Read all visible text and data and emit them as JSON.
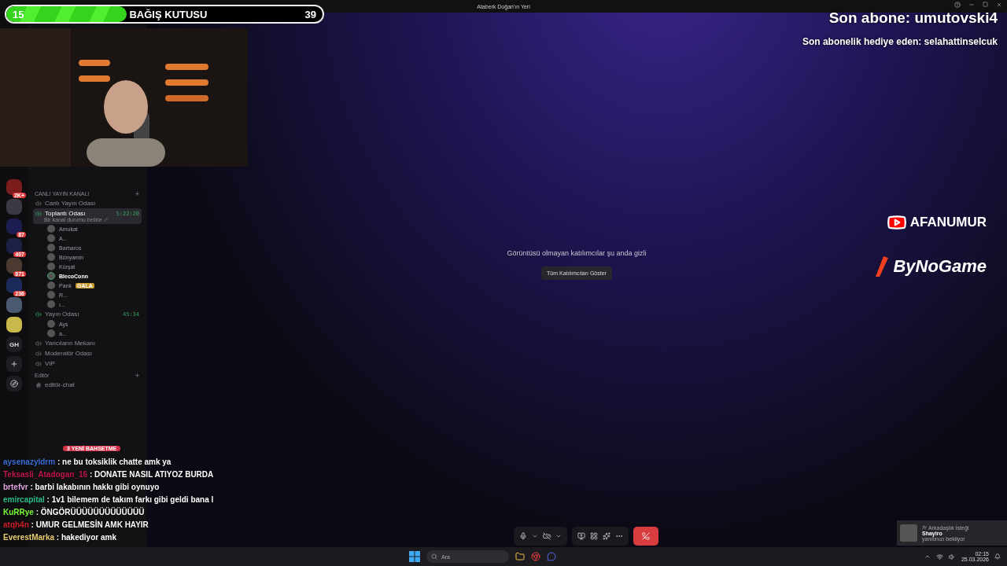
{
  "window": {
    "title": "Ataberk Doğan'ın Yeri"
  },
  "donation_bar": {
    "current": "15",
    "label": "BAĞIŞ KUTUSU",
    "goal": "39",
    "level": 0.38
  },
  "subscriber_overlay": {
    "last_sub": "Son abone: umutovski4",
    "last_gifter": "Son abonelik hediye eden: selahattinselcuk"
  },
  "sponsors": [
    "AFANUMUR",
    "ByNoGame"
  ],
  "servers": [
    {
      "kind": "avatar",
      "badge": "2K+"
    },
    {
      "kind": "avatar"
    },
    {
      "kind": "avatar",
      "badge": "87"
    },
    {
      "kind": "avatar",
      "badge": "407"
    },
    {
      "kind": "avatar",
      "badge": "871"
    },
    {
      "kind": "avatar",
      "badge": "236"
    },
    {
      "kind": "avatar"
    },
    {
      "kind": "avatar"
    },
    {
      "kind": "text",
      "label": "GH"
    },
    {
      "kind": "add"
    },
    {
      "kind": "discover"
    }
  ],
  "categories": [
    {
      "name": "CANLI YAYIN KANALI",
      "channels": [
        {
          "kind": "voice",
          "name": "Canlı Yayın Odası",
          "selected": false
        },
        {
          "kind": "voice",
          "name": "Toplantı Odası",
          "selected": true,
          "timer": "5:22:20",
          "status": "Bir kanal durumu belirle",
          "users": [
            {
              "name": "Amukat",
              "speaking": false
            },
            {
              "name": "A...",
              "speaking": false
            },
            {
              "name": "Barbaros",
              "speaking": false
            },
            {
              "name": "Bünyamin",
              "speaking": false
            },
            {
              "name": "Kürşat",
              "speaking": false
            },
            {
              "name": "BlecoConn",
              "speaking": true
            },
            {
              "name": "Pank",
              "tag": "GALA",
              "speaking": false
            },
            {
              "name": "R...",
              "speaking": false
            },
            {
              "name": "ı...",
              "speaking": false
            }
          ]
        },
        {
          "kind": "voice",
          "name": "Yayın Odası",
          "selected": false,
          "timer": "45:34",
          "users": [
            {
              "name": "Ays",
              "speaking": false
            },
            {
              "name": "a...",
              "speaking": false
            }
          ]
        },
        {
          "kind": "voice",
          "name": "Yancıların Mekanı",
          "selected": false
        },
        {
          "kind": "voice",
          "name": "Moderatör Odası",
          "selected": false
        },
        {
          "kind": "voice",
          "name": "VIP",
          "selected": false
        }
      ]
    },
    {
      "name": "Editör",
      "channels": [
        {
          "kind": "text",
          "name": "editör-chat",
          "selected": false
        }
      ]
    }
  ],
  "mentions_badge": "3 YENİ BAHSETME",
  "stage": {
    "message": "Görüntüsü olmayan katılımcılar şu anda gizli",
    "button": "Tüm Katılımcıları Göster"
  },
  "chat": [
    {
      "user": "aysenazyldrm",
      "color": "#3b6fd8",
      "text": ": ne bu toksiklik chatte amk ya"
    },
    {
      "user": "Teksasli_Atadogan_16",
      "color": "#c2184e",
      "text": ": DONATE NASIL ATIYOZ BURDA"
    },
    {
      "user": "brtefvr",
      "color": "#e3a6e0",
      "text": ": barbi lakabının hakkı gibi oynuyo"
    },
    {
      "user": "emircapital",
      "color": "#2fbf8f",
      "text": ": 1v1 bilemem de takım farkı gibi geldi bana l"
    },
    {
      "user": "KuRRye",
      "color": "#7cff3a",
      "text": ": ÖNGÖRÜÜÜÜÜÜÜÜÜÜÜÜÜ"
    },
    {
      "user": "atqh4n",
      "color": "#d0202a",
      "text": ": UMUR GELMESİN AMK HAYIR"
    },
    {
      "user": "EverestMarka",
      "color": "#e8d070",
      "text": ": hakediyor amk"
    }
  ],
  "notification": {
    "title": "Arkadaşlık İsteği",
    "name": "Shayiro",
    "text": "yanıtınızı bekliyor"
  },
  "taskbar": {
    "search_placeholder": "Ara",
    "time": "02:15",
    "date": "25.03.2026"
  }
}
